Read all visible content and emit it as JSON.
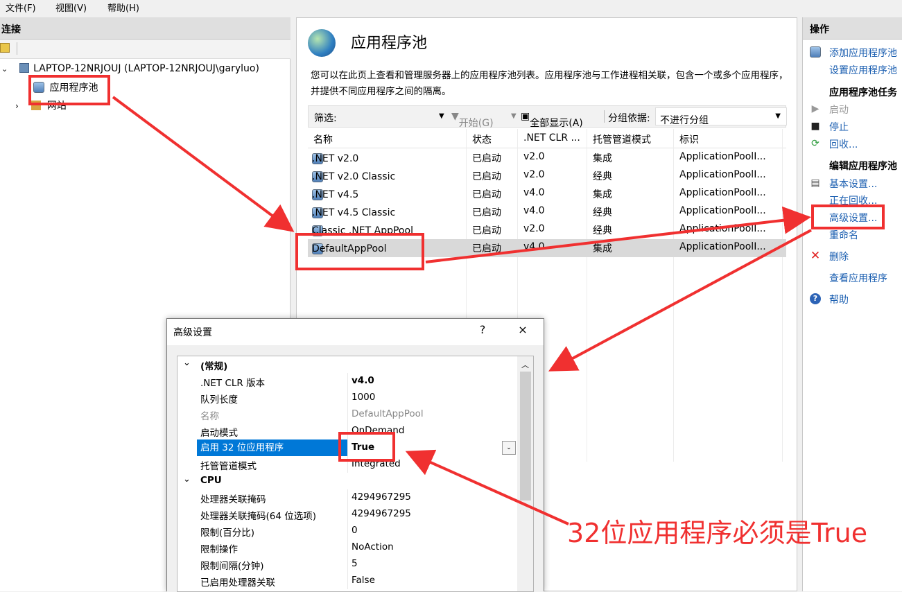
{
  "menu": {
    "file": "文件(F)",
    "view": "视图(V)",
    "help": "帮助(H)"
  },
  "left": {
    "header": "连接",
    "server": "LAPTOP-12NRJOUJ (LAPTOP-12NRJOUJ\\garyluo)",
    "app_pools": "应用程序池",
    "sites": "网站"
  },
  "main": {
    "title": "应用程序池",
    "description": "您可以在此页上查看和管理服务器上的应用程序池列表。应用程序池与工作进程相关联，包含一个或多个应用程序，并提供不同应用程序之间的隔离。",
    "filter_label": "筛选:",
    "start_label": "开始(G)",
    "show_all_label": "全部显示(A)",
    "group_label": "分组依据:",
    "group_value": "不进行分组",
    "columns": [
      "名称",
      "状态",
      ".NET CLR ...",
      "托管管道模式",
      "标识"
    ],
    "rows": [
      {
        "name": ".NET v2.0",
        "status": "已启动",
        "clr": "v2.0",
        "mode": "集成",
        "identity": "ApplicationPoolI..."
      },
      {
        "name": ".NET v2.0 Classic",
        "status": "已启动",
        "clr": "v2.0",
        "mode": "经典",
        "identity": "ApplicationPoolI..."
      },
      {
        "name": ".NET v4.5",
        "status": "已启动",
        "clr": "v4.0",
        "mode": "集成",
        "identity": "ApplicationPoolI..."
      },
      {
        "name": ".NET v4.5 Classic",
        "status": "已启动",
        "clr": "v4.0",
        "mode": "经典",
        "identity": "ApplicationPoolI..."
      },
      {
        "name": "Classic .NET AppPool",
        "status": "已启动",
        "clr": "v2.0",
        "mode": "经典",
        "identity": "ApplicationPoolI..."
      },
      {
        "name": "DefaultAppPool",
        "status": "已启动",
        "clr": "v4.0",
        "mode": "集成",
        "identity": "ApplicationPoolI..."
      }
    ]
  },
  "actions": {
    "header": "操作",
    "add_pool": "添加应用程序池",
    "set_defaults": "设置应用程序池",
    "tasks_header": "应用程序池任务",
    "start": "启动",
    "stop": "停止",
    "recycle": "回收...",
    "edit_header": "编辑应用程序池",
    "basic_settings": "基本设置...",
    "recycling": "正在回收...",
    "advanced_settings": "高级设置...",
    "rename": "重命名",
    "delete": "删除",
    "view_apps": "查看应用程序",
    "help": "帮助"
  },
  "dialog": {
    "title": "高级设置",
    "help_btn": "?",
    "close_btn": "×",
    "cat_general": "(常规)",
    "cat_cpu": "CPU",
    "props": [
      {
        "k": ".NET CLR 版本",
        "v": "v4.0"
      },
      {
        "k": "队列长度",
        "v": "1000"
      },
      {
        "k": "名称",
        "v": "DefaultAppPool"
      },
      {
        "k": "启动模式",
        "v": "OnDemand"
      },
      {
        "k": "启用 32 位应用程序",
        "v": "True"
      },
      {
        "k": "托管管道模式",
        "v": "Integrated"
      }
    ],
    "cpu_props": [
      {
        "k": "处理器关联掩码",
        "v": "4294967295"
      },
      {
        "k": "处理器关联掩码(64 位选项)",
        "v": "4294967295"
      },
      {
        "k": "限制(百分比)",
        "v": "0"
      },
      {
        "k": "限制操作",
        "v": "NoAction"
      },
      {
        "k": "限制间隔(分钟)",
        "v": "5"
      },
      {
        "k": "已启用处理器关联",
        "v": "False"
      }
    ]
  },
  "annotation": "32位应用程序必须是True",
  "colors": {
    "annotation_red": "#f03030",
    "selection_blue": "#0078d7",
    "link_blue": "#1a5eb0"
  }
}
